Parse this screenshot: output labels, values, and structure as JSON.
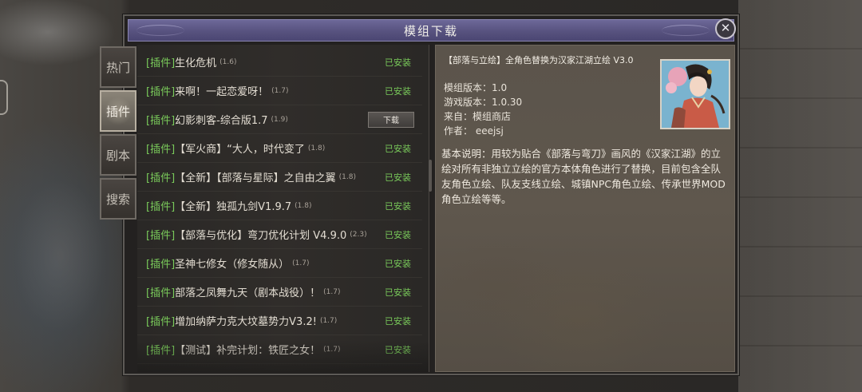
{
  "dialog": {
    "title": "模组下载",
    "close_glyph": "✕"
  },
  "tabs": [
    {
      "label": "热门",
      "active": false
    },
    {
      "label": "插件",
      "active": true
    },
    {
      "label": "剧本",
      "active": false
    },
    {
      "label": "搜索",
      "active": false
    }
  ],
  "mods": [
    {
      "tag": "[插件]",
      "name": "生化危机",
      "version": "(1.6)",
      "status": "已安装"
    },
    {
      "tag": "[插件]",
      "name": "来啊！一起恋爱呀！",
      "version": "(1.7)",
      "status": "已安装"
    },
    {
      "tag": "[插件]",
      "name": "幻影刺客-综合版1.7",
      "version": "(1.9)",
      "status": "",
      "button": "下载"
    },
    {
      "tag": "[插件]",
      "name": "【军火商】“大人，时代变了",
      "version": "(1.8)",
      "status": "已安装"
    },
    {
      "tag": "[插件]",
      "name": "【全新】【部落与星际】之自由之翼",
      "version": "(1.8)",
      "status": "已安装"
    },
    {
      "tag": "[插件]",
      "name": "【全新】独孤九剑V1.9.7",
      "version": "(1.8)",
      "status": "已安装"
    },
    {
      "tag": "[插件]",
      "name": "【部落与优化】弯刀优化计划 V4.9.0",
      "version": "(2.3)",
      "status": "已安装"
    },
    {
      "tag": "[插件]",
      "name": "圣神七修女（修女随从）",
      "version": "(1.7)",
      "status": "已安装"
    },
    {
      "tag": "[插件]",
      "name": "部落之凤舞九天（剧本战役）！",
      "version": "(1.7)",
      "status": "已安装"
    },
    {
      "tag": "[插件]",
      "name": "增加纳萨力克大坟墓势力V3.2!",
      "version": "(1.7)",
      "status": "已安装"
    },
    {
      "tag": "[插件]",
      "name": "【测试】补完计划：铁匠之女！",
      "version": "(1.7)",
      "status": "已安装"
    }
  ],
  "detail": {
    "title": "【部落与立绘】全角色替换为汉家江湖立绘 V3.0",
    "mod_version": "模组版本：1.0",
    "game_version": "游戏版本：1.0.30",
    "source": "来自：模组商店",
    "author": "作者：  eeejsj",
    "description": "基本说明：用较为贴合《部落与弯刀》画风的《汉家江湖》的立绘对所有非独立立绘的官方本体角色进行了替换，目前包含全队友角色立绘、队友支线立绘、城镇NPC角色立绘、传承世界MOD角色立绘等等。",
    "portrait_icon": "character-portrait"
  },
  "colors": {
    "tag_green": "#79c95a",
    "title_purple": "#57527f"
  }
}
